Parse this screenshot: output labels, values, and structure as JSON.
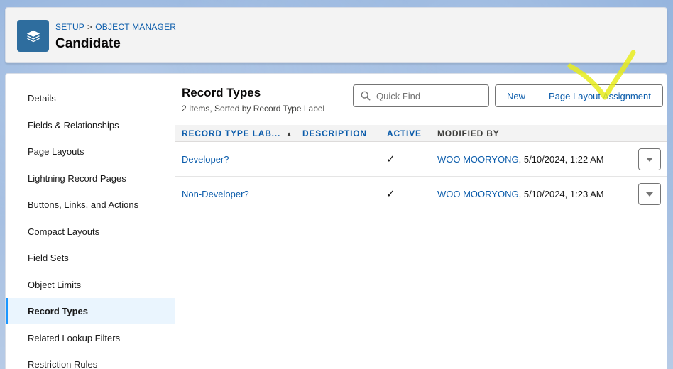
{
  "header": {
    "breadcrumb": [
      "SETUP",
      "OBJECT MANAGER"
    ],
    "breadcrumb_separator": ">",
    "title": "Candidate",
    "icon": "stacked-layers-icon"
  },
  "sidebar": {
    "items": [
      {
        "label": "Details"
      },
      {
        "label": "Fields & Relationships"
      },
      {
        "label": "Page Layouts"
      },
      {
        "label": "Lightning Record Pages"
      },
      {
        "label": "Buttons, Links, and Actions"
      },
      {
        "label": "Compact Layouts"
      },
      {
        "label": "Field Sets"
      },
      {
        "label": "Object Limits"
      },
      {
        "label": "Record Types",
        "active": true
      },
      {
        "label": "Related Lookup Filters"
      },
      {
        "label": "Restriction Rules"
      }
    ]
  },
  "main": {
    "title": "Record Types",
    "subtitle": "2 Items, Sorted by Record Type Label",
    "search": {
      "placeholder": "Quick Find",
      "value": ""
    },
    "buttons": {
      "new": "New",
      "page_layout_assignment": "Page Layout Assignment"
    },
    "columns": [
      "RECORD TYPE LAB...",
      "DESCRIPTION",
      "ACTIVE",
      "MODIFIED BY"
    ],
    "rows": [
      {
        "label": "Developer?",
        "description": "",
        "active": "✓",
        "modified_by": "WOO MOORYONG",
        "modified_date": ", 5/10/2024, 1:22 AM"
      },
      {
        "label": "Non-Developer?",
        "description": "",
        "active": "✓",
        "modified_by": "WOO MOORYONG",
        "modified_date": ", 5/10/2024, 1:23 AM"
      }
    ]
  },
  "colors": {
    "link": "#0b5cab",
    "icon_bg": "#2e6d9e",
    "active_nav_bg": "#eaf5fe",
    "active_nav_bar": "#1b96ff",
    "annotation": "#e8ec1c"
  }
}
